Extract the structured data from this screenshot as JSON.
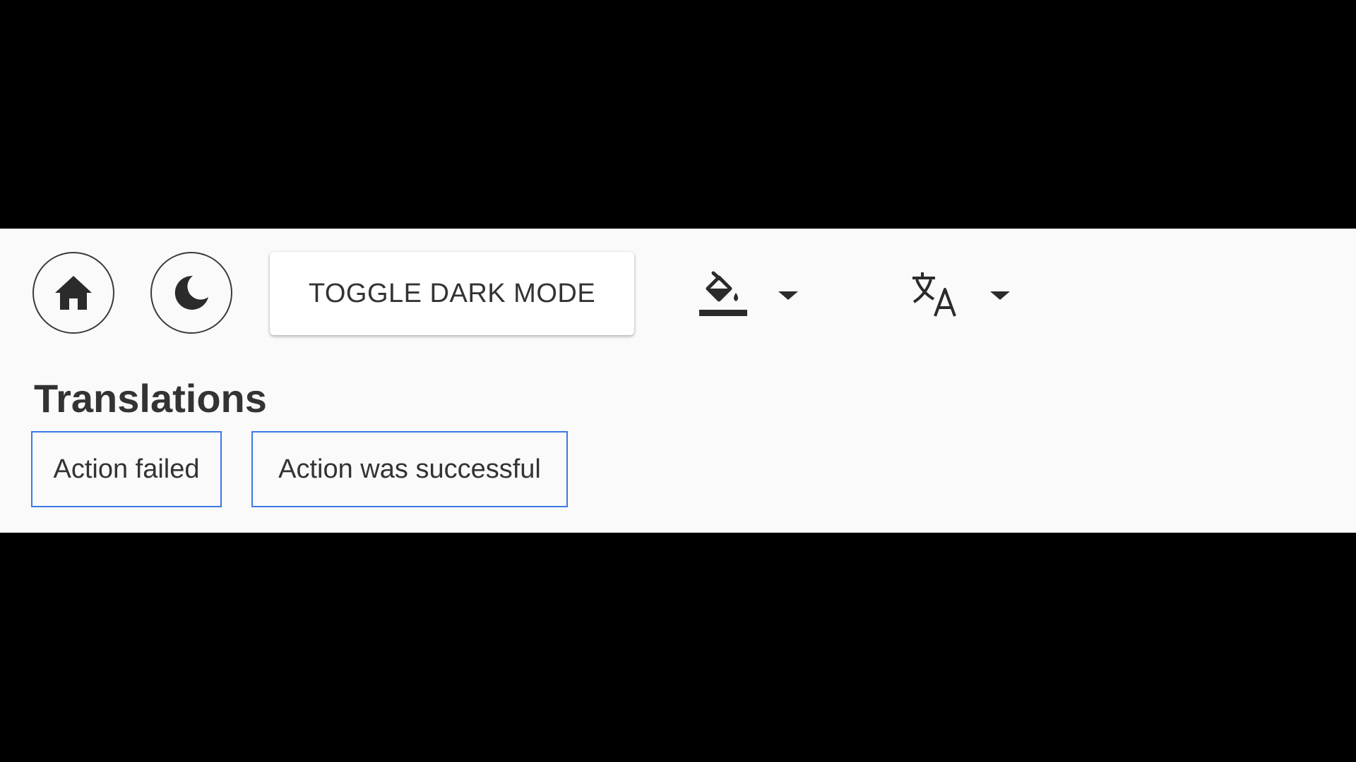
{
  "toolbar": {
    "home_icon": "home-icon",
    "moon_icon": "moon-icon",
    "toggle_dark_label": "TOGGLE DARK MODE",
    "theme_icon": "paint-bucket-icon",
    "language_icon": "translate-icon"
  },
  "translations": {
    "title": "Translations",
    "items": [
      {
        "label": "Action failed"
      },
      {
        "label": "Action was successful"
      }
    ]
  },
  "colors": {
    "background": "#fafafa",
    "letterbox": "#000000",
    "chip_border": "#3b78e7",
    "text": "#333333"
  }
}
